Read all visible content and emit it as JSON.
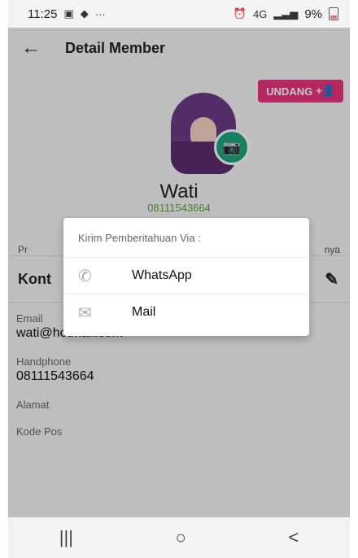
{
  "status": {
    "time": "11:25",
    "signal": "4G",
    "battery": "9%"
  },
  "appbar": {
    "title": "Detail Member"
  },
  "profile": {
    "name": "Wati",
    "phone": "08111543664",
    "invite": "UNDANG"
  },
  "tabs": {
    "left": "Pr",
    "right": "nya"
  },
  "contact": {
    "title": "Kont"
  },
  "fields": [
    {
      "label": "Email",
      "value": "wati@hotmail.com"
    },
    {
      "label": "Handphone",
      "value": "08111543664"
    },
    {
      "label": "Alamat",
      "value": ""
    },
    {
      "label": "Kode Pos",
      "value": ""
    }
  ],
  "dialog": {
    "title": "Kirim Pemberitahuan Via :",
    "items": [
      {
        "label": "WhatsApp"
      },
      {
        "label": "Mail"
      }
    ]
  },
  "navbar": {
    "recent": "|||",
    "home": "○",
    "back": "<"
  }
}
